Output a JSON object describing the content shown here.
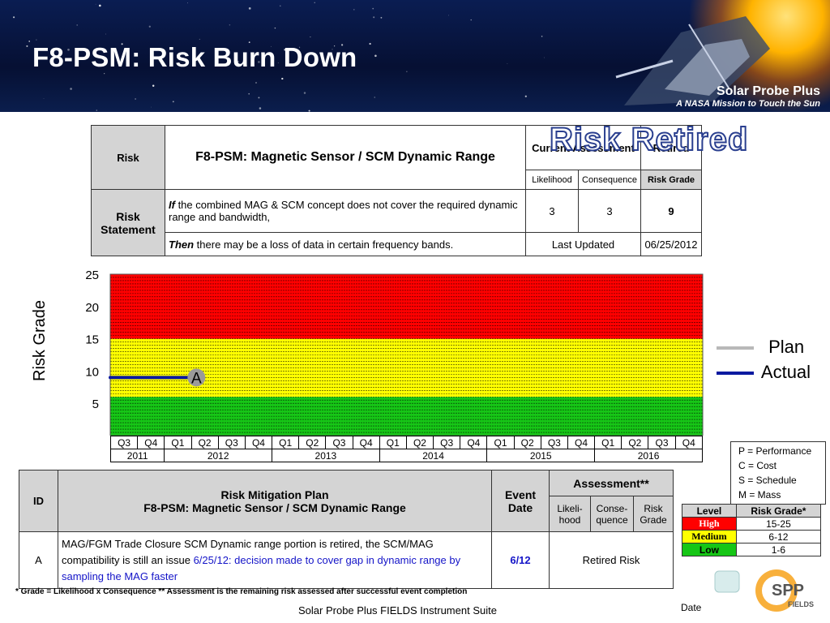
{
  "banner": {
    "title": "F8-PSM: Risk Burn Down",
    "brand_name": "Solar Probe Plus",
    "brand_tagline": "A NASA Mission to Touch the Sun"
  },
  "risk_table": {
    "risk_label": "Risk",
    "risk_title": "F8-PSM: Magnetic Sensor / SCM Dynamic Range",
    "current_assessment": "Current Assessment",
    "retired_header": "Retired",
    "likelihood": "Likelihood",
    "consequence": "Consequence",
    "risk_grade": "Risk Grade",
    "statement_label": "Risk Statement",
    "if_word": "If",
    "if_text": " the combined MAG & SCM concept does not cover the required dynamic range and bandwidth,",
    "then_word": "Then",
    "then_text": " there may be a loss of data in certain frequency bands.",
    "likelihood_value": "3",
    "consequence_value": "3",
    "grade_value": "9",
    "last_updated_label": "Last Updated",
    "last_updated_value": "06/25/2012"
  },
  "stamp": "Risk Retired",
  "chart_data": {
    "type": "line",
    "ylabel": "Risk Grade",
    "ylim": [
      0,
      25
    ],
    "yticks": [
      5,
      10,
      15,
      20,
      25
    ],
    "bands": [
      {
        "level": "Low",
        "from": 0,
        "to": 6,
        "color": "#16c616"
      },
      {
        "level": "Medium",
        "from": 6,
        "to": 15,
        "color": "#ffff00"
      },
      {
        "level": "High",
        "from": 15,
        "to": 25,
        "color": "#ff0000"
      }
    ],
    "quarters": [
      "Q3",
      "Q4",
      "Q1",
      "Q2",
      "Q3",
      "Q4",
      "Q1",
      "Q2",
      "Q3",
      "Q4",
      "Q1",
      "Q2",
      "Q3",
      "Q4",
      "Q1",
      "Q2",
      "Q3",
      "Q4",
      "Q1",
      "Q2",
      "Q3",
      "Q4"
    ],
    "years": [
      {
        "label": "2011",
        "span": 2
      },
      {
        "label": "2012",
        "span": 4
      },
      {
        "label": "2013",
        "span": 4
      },
      {
        "label": "2014",
        "span": 4
      },
      {
        "label": "2015",
        "span": 4
      },
      {
        "label": "2016",
        "span": 4
      }
    ],
    "series": [
      {
        "name": "Plan",
        "color": "#b8b8b8",
        "points": []
      },
      {
        "name": "Actual",
        "color": "#0a1aa0",
        "points": [
          {
            "x": 0,
            "y": 9
          },
          {
            "x": 3,
            "y": 9
          }
        ]
      }
    ],
    "event_markers": [
      {
        "label": "A",
        "x": 3.2,
        "y": 9
      }
    ],
    "legend_position": "right"
  },
  "key": {
    "items": [
      "P = Performance",
      "C = Cost",
      "S = Schedule",
      "M = Mass"
    ]
  },
  "levels": {
    "header_level": "Level",
    "header_grade": "Risk Grade*",
    "rows": [
      {
        "level": "High",
        "grade": "15-25",
        "color": "#ff0000",
        "text_color": "#ffffff"
      },
      {
        "level": "Medium",
        "grade": "6-12",
        "color": "#ffff00",
        "text_color": "#000000"
      },
      {
        "level": "Low",
        "grade": "1-6",
        "color": "#16c616",
        "text_color": "#000000"
      }
    ]
  },
  "mitigation": {
    "id_header": "ID",
    "plan_header_line1": "Risk Mitigation Plan",
    "plan_header_line2": "F8-PSM:  Magnetic Sensor / SCM Dynamic Range",
    "event_date_header": "Event Date",
    "assessment_header": "Assessment**",
    "likelihood_header": "Likeli-hood",
    "consequence_header": "Conse-quence",
    "grade_header": "Risk Grade",
    "row_id": "A",
    "row_text_black": "MAG/FGM Trade Closure SCM Dynamic range portion is retired, the SCM/MAG compatibility is still an issue ",
    "row_text_blue": "6/25/12: decision made to cover gap in dynamic range by sampling the MAG faster",
    "row_date": "6/12",
    "row_assessment": "Retired Risk"
  },
  "footnote": "* Grade = Likelihood x Consequence   ** Assessment is the remaining risk assessed after successful event completion",
  "footer": "Solar Probe Plus FIELDS Instrument Suite",
  "date_label": "Date",
  "logo_text": "SPP",
  "logo_sub": "FIELDS"
}
